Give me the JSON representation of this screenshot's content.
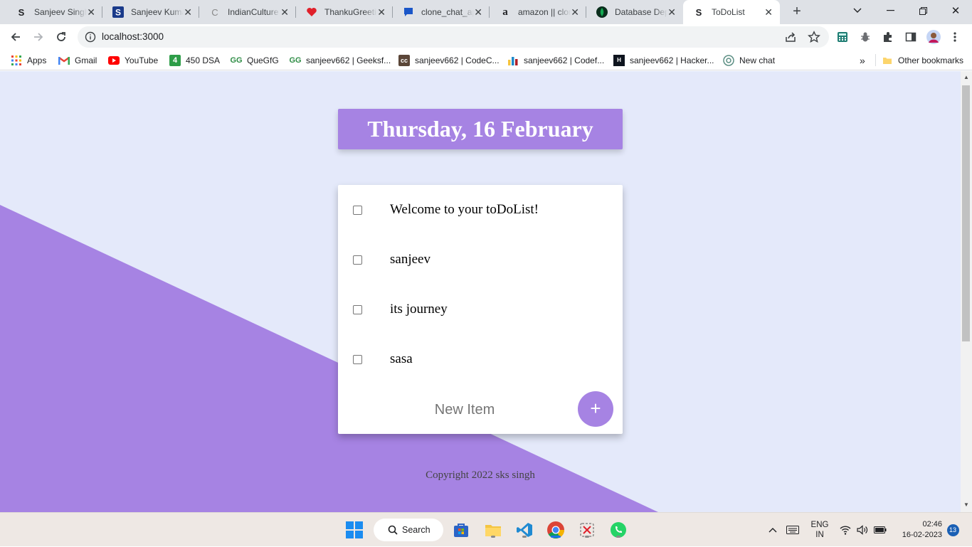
{
  "browser": {
    "tabs": [
      {
        "title": "Sanjeev Singh",
        "favicon": "S",
        "favicon_color": "#202124"
      },
      {
        "title": "Sanjeev Kumar",
        "favicon": "S",
        "favicon_color": "#1a3a8a"
      },
      {
        "title": "IndianCulture",
        "favicon": "C",
        "favicon_color": "#777777"
      },
      {
        "title": "ThankuGreeting",
        "favicon": "heart",
        "favicon_color": "#e0202a"
      },
      {
        "title": "clone_chat_app",
        "favicon": "chat",
        "favicon_color": "#1a56c8"
      },
      {
        "title": "amazon || clone",
        "favicon": "a",
        "favicon_color": "#202124"
      },
      {
        "title": "Database Deployment",
        "favicon": "leaf",
        "favicon_color": "#13aa52"
      },
      {
        "title": "ToDoList",
        "favicon": "S",
        "favicon_color": "#202124",
        "active": true
      }
    ],
    "new_tab_label": "+",
    "address": "localhost:3000"
  },
  "bookmarks": [
    {
      "label": "Apps",
      "icon": "apps-grid-icon"
    },
    {
      "label": "Gmail",
      "icon": "gmail-icon"
    },
    {
      "label": "YouTube",
      "icon": "youtube-icon"
    },
    {
      "label": "450 DSA",
      "icon": "4",
      "icon_color": "#2e9d48"
    },
    {
      "label": "QueGfG",
      "icon": "gfg-icon"
    },
    {
      "label": "sanjeev662 | Geeksf...",
      "icon": "gfg-icon"
    },
    {
      "label": "sanjeev662 | CodeC...",
      "icon": "codechef-icon"
    },
    {
      "label": "sanjeev662 | Codef...",
      "icon": "codeforces-icon"
    },
    {
      "label": "sanjeev662 | Hacker...",
      "icon": "hackerrank-icon"
    },
    {
      "label": "New chat",
      "icon": "openai-icon"
    }
  ],
  "bookmarks_overflow": "»",
  "other_bookmarks": "Other bookmarks",
  "page": {
    "heading": "Thursday, 16 February",
    "items": [
      "Welcome to your toDoList!",
      "sanjeev",
      "its journey",
      "sasa"
    ],
    "new_item_placeholder": "New Item",
    "add_button": "+",
    "footer": "Copyright 2022 sks singh",
    "colors": {
      "accent": "#a683e3",
      "background": "#e4e9fa"
    }
  },
  "taskbar": {
    "search_label": "Search",
    "lang_top": "ENG",
    "lang_bottom": "IN",
    "time": "02:46",
    "date": "16-02-2023",
    "notifications": "13"
  }
}
